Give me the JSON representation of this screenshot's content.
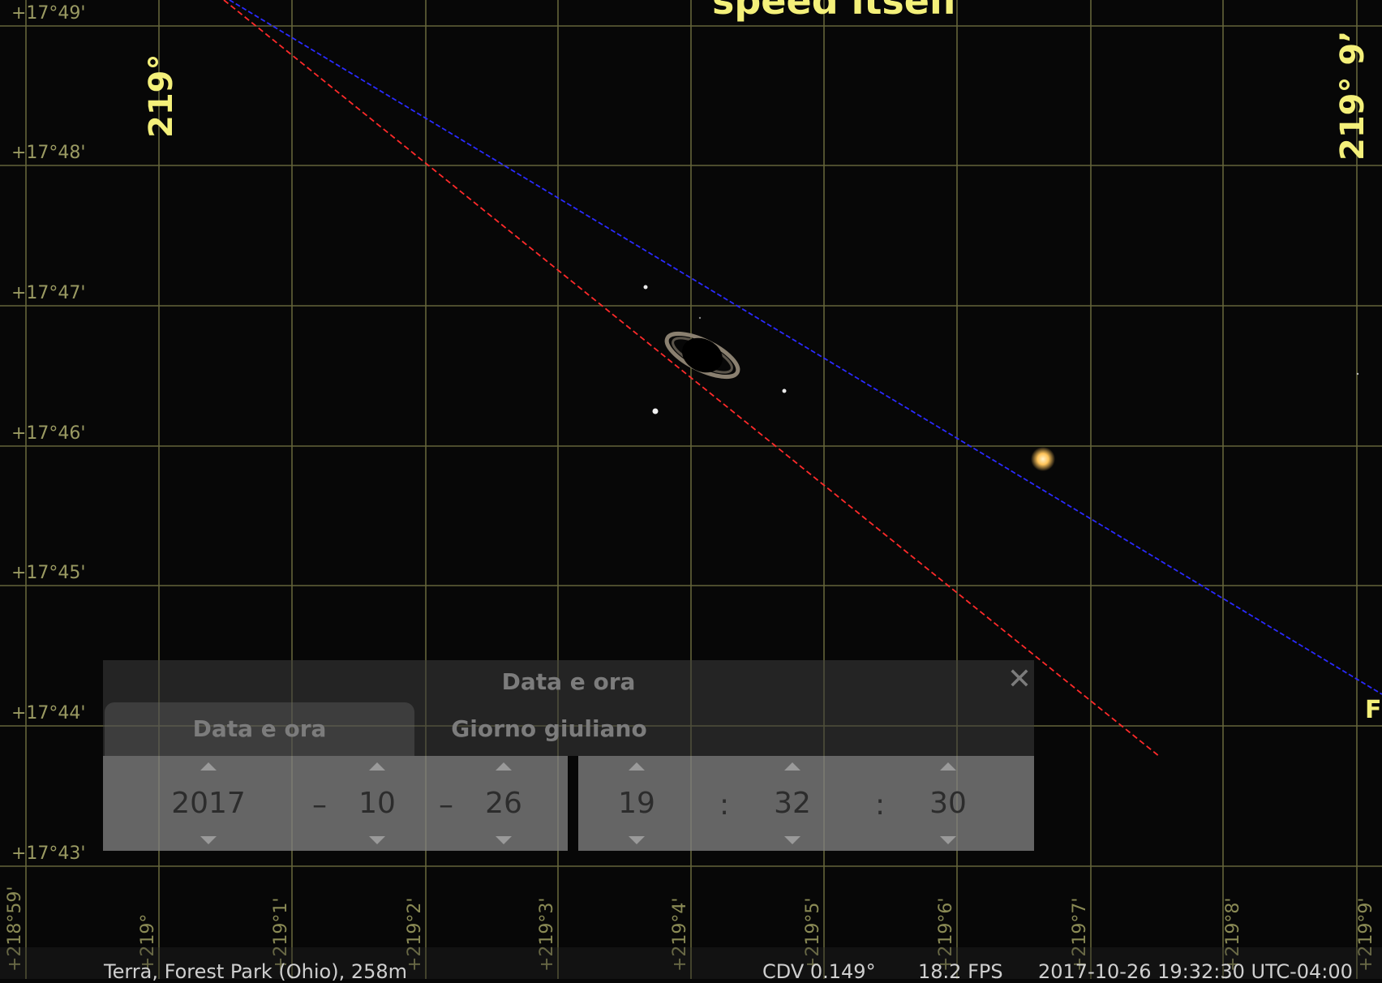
{
  "sky_labels": {
    "top_text": "speed itself",
    "ra_big_left": "219°",
    "ra_big_right": "219° 9’",
    "right_edge_letter": "F",
    "dec_labels": [
      "+17°49'",
      "+17°48'",
      "+17°47'",
      "+17°46'",
      "+17°45'",
      "+17°44'",
      "+17°43'"
    ],
    "ra_labels": [
      "+218°59'",
      "+219°",
      "+219°1'",
      "+219°2'",
      "+219°3'",
      "+219°4'",
      "+219°5'",
      "+219°6'",
      "+219°7'",
      "+219°8'",
      "+219°9'"
    ]
  },
  "colors": {
    "grid": "#64643a",
    "ecliptic": "#ff2a2a",
    "equator": "#2a2aff",
    "label_yellow": "#f4f07a"
  },
  "dialog": {
    "title": "Data e ora",
    "close_icon": "close-icon",
    "tabs": [
      "Data e ora",
      "Giorno giuliano"
    ],
    "date": {
      "year": "2017",
      "month": "10",
      "day": "26",
      "separator": "–"
    },
    "time": {
      "hour": "19",
      "minute": "32",
      "second": "30",
      "separator": ":"
    }
  },
  "status_bar": {
    "location": "Terra, Forest Park (Ohio), 258m",
    "fov": "CDV 0.149°",
    "fps": "18.2 FPS",
    "datetime": "2017-10-26 19:32:30 UTC-04:00"
  }
}
